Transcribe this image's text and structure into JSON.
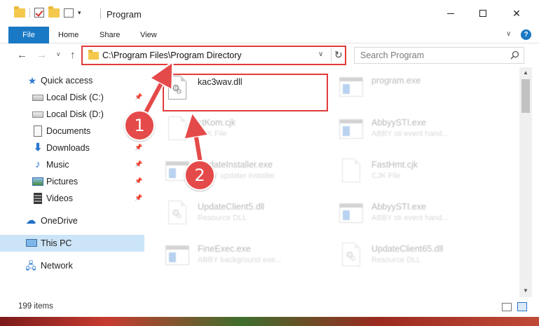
{
  "window": {
    "title": "Program"
  },
  "ribbon": {
    "tabs": [
      "File",
      "Home",
      "Share",
      "View"
    ]
  },
  "address": {
    "path": "C:\\Program Files\\Program Directory"
  },
  "search": {
    "placeholder": "Search Program"
  },
  "sidebar": {
    "items": [
      {
        "label": "Quick access",
        "icon": "star-icon"
      },
      {
        "label": "Local Disk (C:)",
        "icon": "drive-icon",
        "pinned": true
      },
      {
        "label": "Local Disk (D:)",
        "icon": "drive-icon",
        "pinned": false
      },
      {
        "label": "Documents",
        "icon": "documents-icon",
        "pinned": true
      },
      {
        "label": "Downloads",
        "icon": "download-icon",
        "pinned": true
      },
      {
        "label": "Music",
        "icon": "music-icon",
        "pinned": true
      },
      {
        "label": "Pictures",
        "icon": "pictures-icon",
        "pinned": true
      },
      {
        "label": "Videos",
        "icon": "video-icon",
        "pinned": true
      },
      {
        "label": "OneDrive",
        "icon": "cloud-icon"
      },
      {
        "label": "This PC",
        "icon": "computer-icon",
        "selected": true
      },
      {
        "label": "Network",
        "icon": "network-icon"
      }
    ]
  },
  "files": [
    {
      "name": "kac3wav.dll",
      "desc": "",
      "type": "dll",
      "highlighted": true
    },
    {
      "name": "program.exe",
      "desc": "",
      "type": "exe"
    },
    {
      "name": "AbbyySTI.exe",
      "desc": "ABBY sti event hand...",
      "type": "exe"
    },
    {
      "name": "UpdateInstaller.exe",
      "desc": "ABBY updater installer",
      "type": "exe"
    },
    {
      "name": "FastHmt.cjk",
      "desc": "CJK File",
      "type": "doc"
    },
    {
      "name": "UpdateClient5.dll",
      "desc": "Resource DLL",
      "type": "dll"
    },
    {
      "name": "AbbyySTI.exe",
      "desc": "ABBY sti event hand...",
      "type": "exe"
    },
    {
      "name": "FineExec.exe",
      "desc": "ABBY background exe...",
      "type": "exe"
    },
    {
      "name": "UpdateClient65.dll",
      "desc": "Resource DLL",
      "type": "dll"
    }
  ],
  "partial_file": {
    "name": "stKom.cjk",
    "desc": "CJK File"
  },
  "status": {
    "items": "199 items"
  },
  "annotations": {
    "step1": "1",
    "step2": "2"
  },
  "colors": {
    "accent": "#1a79c4",
    "highlight": "#e23a3a",
    "badge": "#e54a4a",
    "selected_nav": "#cce4f7"
  }
}
